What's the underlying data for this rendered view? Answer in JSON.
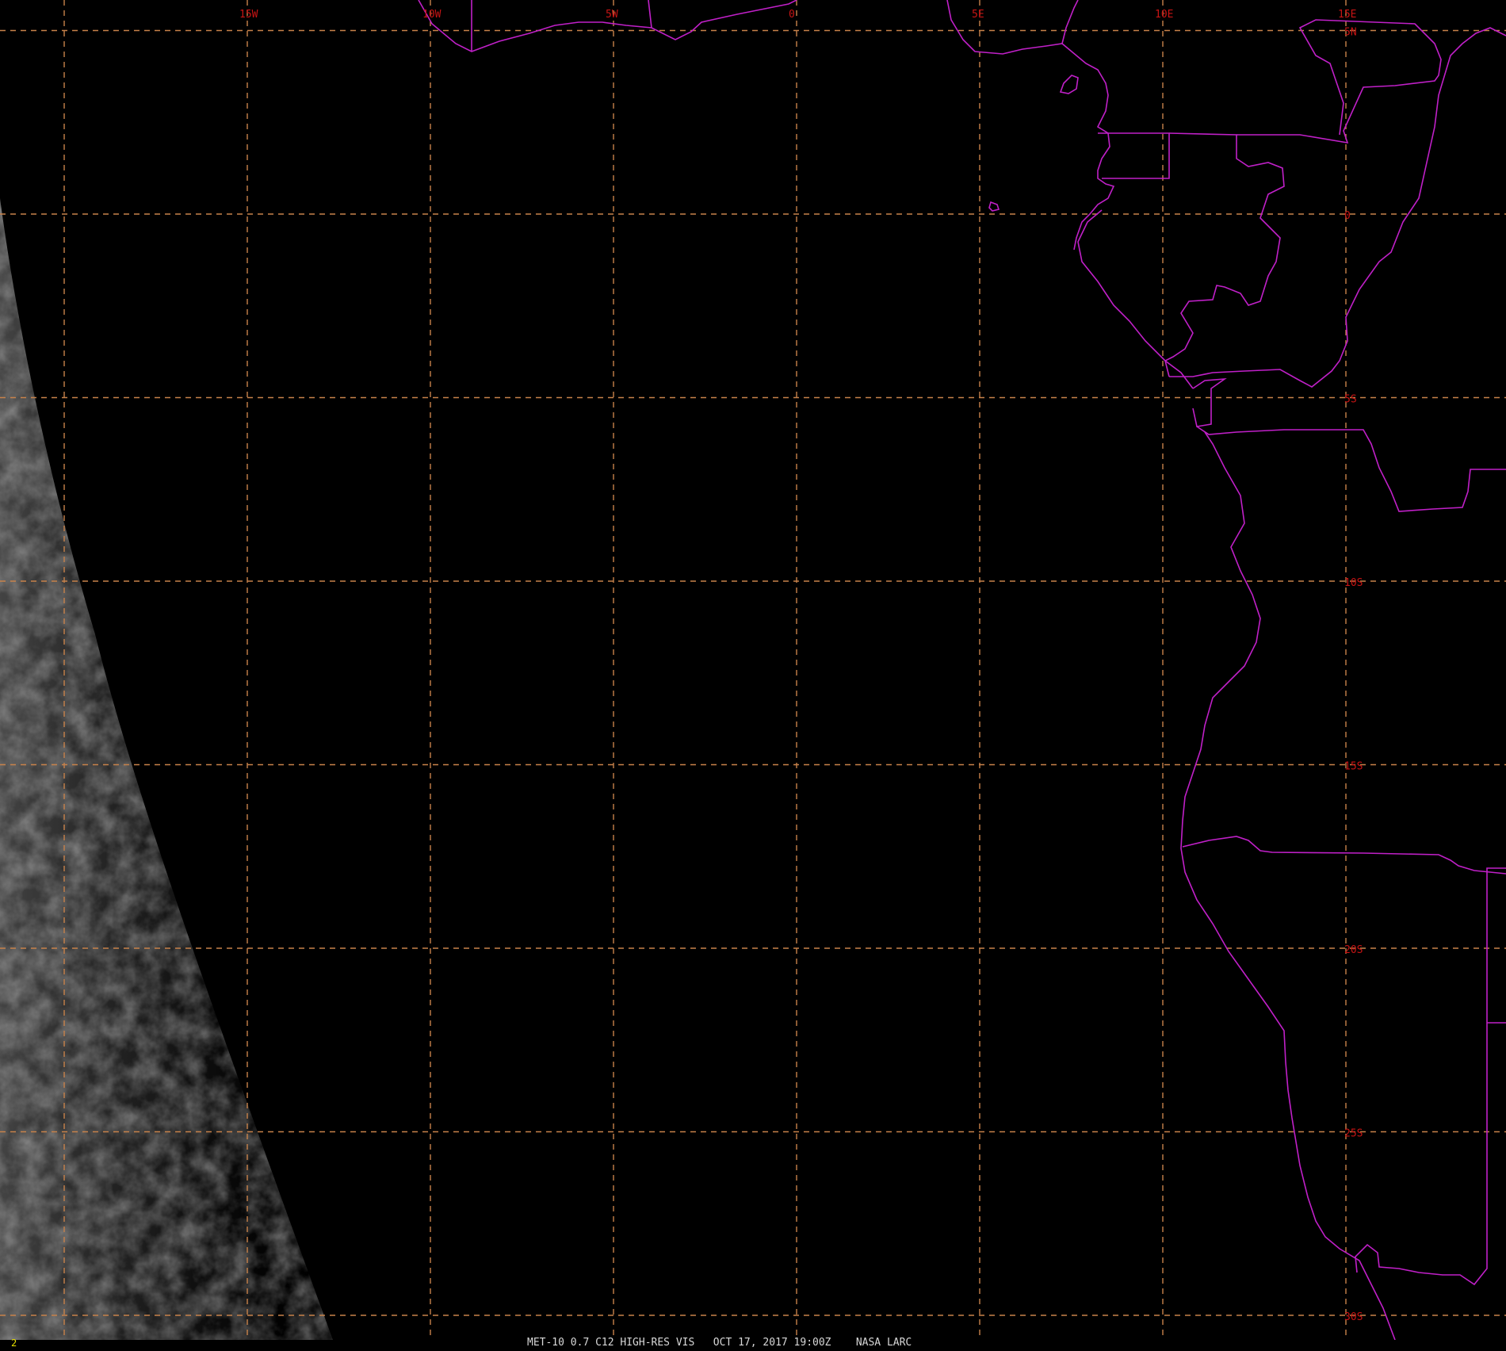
{
  "map": {
    "frame_number": "2",
    "caption": "MET-10 0.7 C12 HIGH-RES VIS   OCT 17, 2017 19:00Z    NASA LARC",
    "colors": {
      "background": "#000000",
      "graticule": "#c8824a",
      "graticule_labels": "#c81414",
      "boundaries": "#c020c8",
      "caption": "#d8d8d8",
      "frame_number": "#e8e000"
    },
    "longitude_labels": [
      "15W",
      "10W",
      "5W",
      "0",
      "5E",
      "10E",
      "15E"
    ],
    "latitude_labels": [
      "5N",
      "0",
      "5S",
      "10S",
      "15S",
      "20S",
      "25S",
      "30S"
    ],
    "longitudes_deg": [
      -15,
      -10,
      -5,
      0,
      5,
      10,
      15
    ],
    "latitudes_deg": [
      5,
      0,
      -5,
      -10,
      -15,
      -20,
      -25,
      -30
    ],
    "graticule_style": "dashed",
    "imagery": "visible channel, night side with faint cloud texture near the western terminator"
  }
}
